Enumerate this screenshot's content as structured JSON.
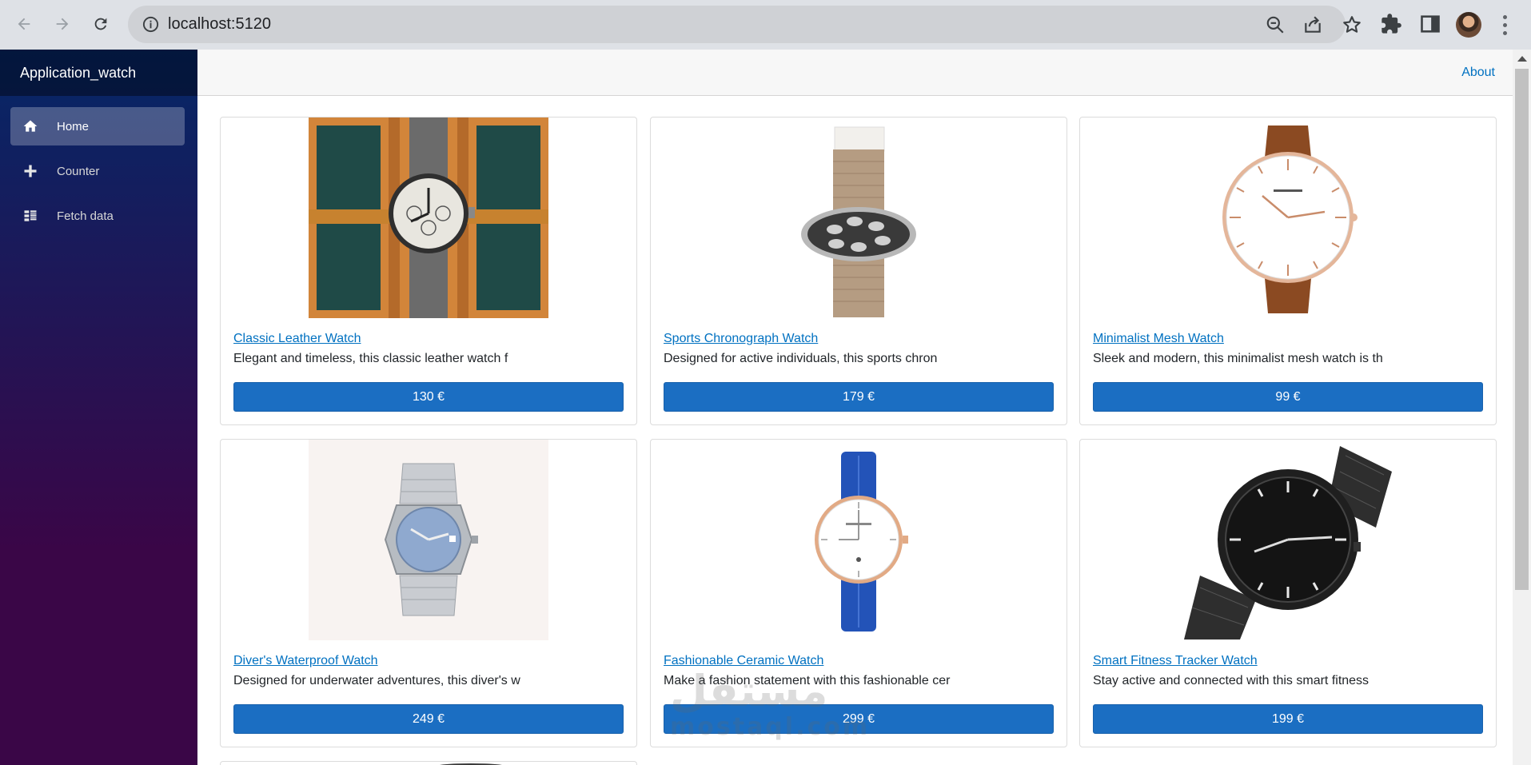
{
  "browser": {
    "url": "localhost:5120",
    "icons": [
      "back-icon",
      "forward-icon",
      "reload-icon",
      "site-info-icon",
      "zoom-icon",
      "share-icon",
      "bookmark-star-icon",
      "extensions-icon",
      "side-panel-icon",
      "profile-avatar",
      "menu-icon"
    ]
  },
  "app": {
    "brand": "Application_watch",
    "nav": [
      {
        "label": "Home",
        "icon": "home-icon",
        "active": true
      },
      {
        "label": "Counter",
        "icon": "plus-icon",
        "active": false
      },
      {
        "label": "Fetch data",
        "icon": "list-icon",
        "active": false
      }
    ],
    "top_link": "About"
  },
  "products": [
    {
      "name": "Classic Leather Watch",
      "description": "Elegant and timeless, this classic leather watch f",
      "price": "130 €"
    },
    {
      "name": "Sports Chronograph Watch",
      "description": "Designed for active individuals, this sports chron",
      "price": "179 €"
    },
    {
      "name": "Minimalist Mesh Watch",
      "description": "Sleek and modern, this minimalist mesh watch is th",
      "price": "99 €"
    },
    {
      "name": "Diver's Waterproof Watch",
      "description": "Designed for underwater adventures, this diver's w",
      "price": "249 €"
    },
    {
      "name": "Fashionable Ceramic Watch",
      "description": "Make a fashion statement with this fashionable cer",
      "price": "299 €"
    },
    {
      "name": "Smart Fitness Tracker Watch",
      "description": "Stay active and connected with this smart fitness",
      "price": "199 €"
    }
  ],
  "watermark": {
    "arabic": "مستقل",
    "latin": "mostaql.com"
  },
  "colors": {
    "accent": "#1b6ec2",
    "link": "#0071c1",
    "sidebar_top": "#052767",
    "sidebar_bottom": "#3a0647"
  }
}
